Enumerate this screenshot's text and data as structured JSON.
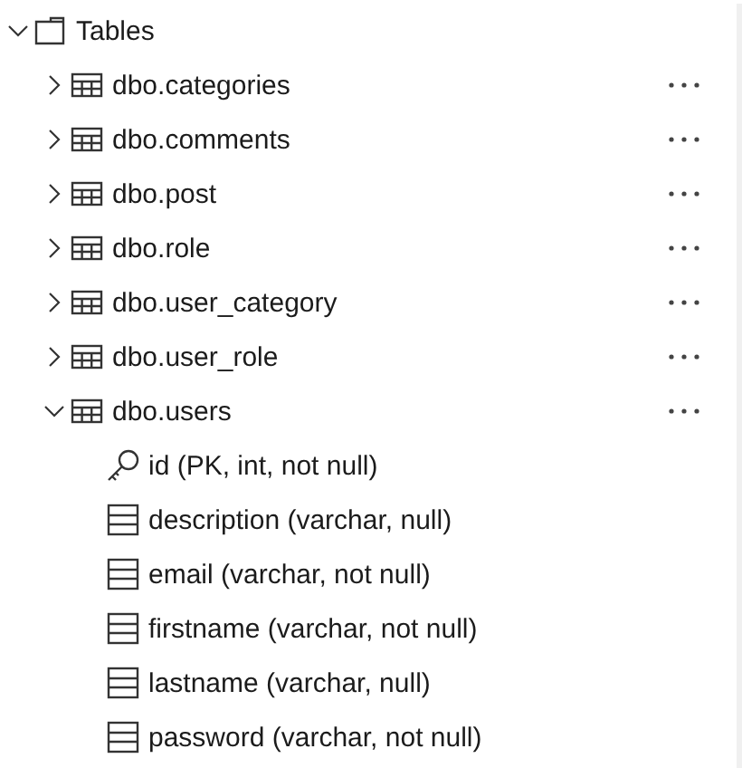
{
  "tree": [
    {
      "kind": "folder",
      "label": "Tables",
      "expanded": true,
      "children": [
        {
          "kind": "table",
          "label": "dbo.categories",
          "expanded": false
        },
        {
          "kind": "table",
          "label": "dbo.comments",
          "expanded": false
        },
        {
          "kind": "table",
          "label": "dbo.post",
          "expanded": false
        },
        {
          "kind": "table",
          "label": "dbo.role",
          "expanded": false
        },
        {
          "kind": "table",
          "label": "dbo.user_category",
          "expanded": false
        },
        {
          "kind": "table",
          "label": "dbo.user_role",
          "expanded": false
        },
        {
          "kind": "table",
          "label": "dbo.users",
          "expanded": true,
          "children": [
            {
              "kind": "key",
              "label": "id (PK, int, not null)"
            },
            {
              "kind": "column",
              "label": "description (varchar, null)"
            },
            {
              "kind": "column",
              "label": "email (varchar, not null)"
            },
            {
              "kind": "column",
              "label": "firstname (varchar, not null)"
            },
            {
              "kind": "column",
              "label": "lastname (varchar, null)"
            },
            {
              "kind": "column",
              "label": "password (varchar, not null)"
            }
          ]
        }
      ]
    }
  ]
}
